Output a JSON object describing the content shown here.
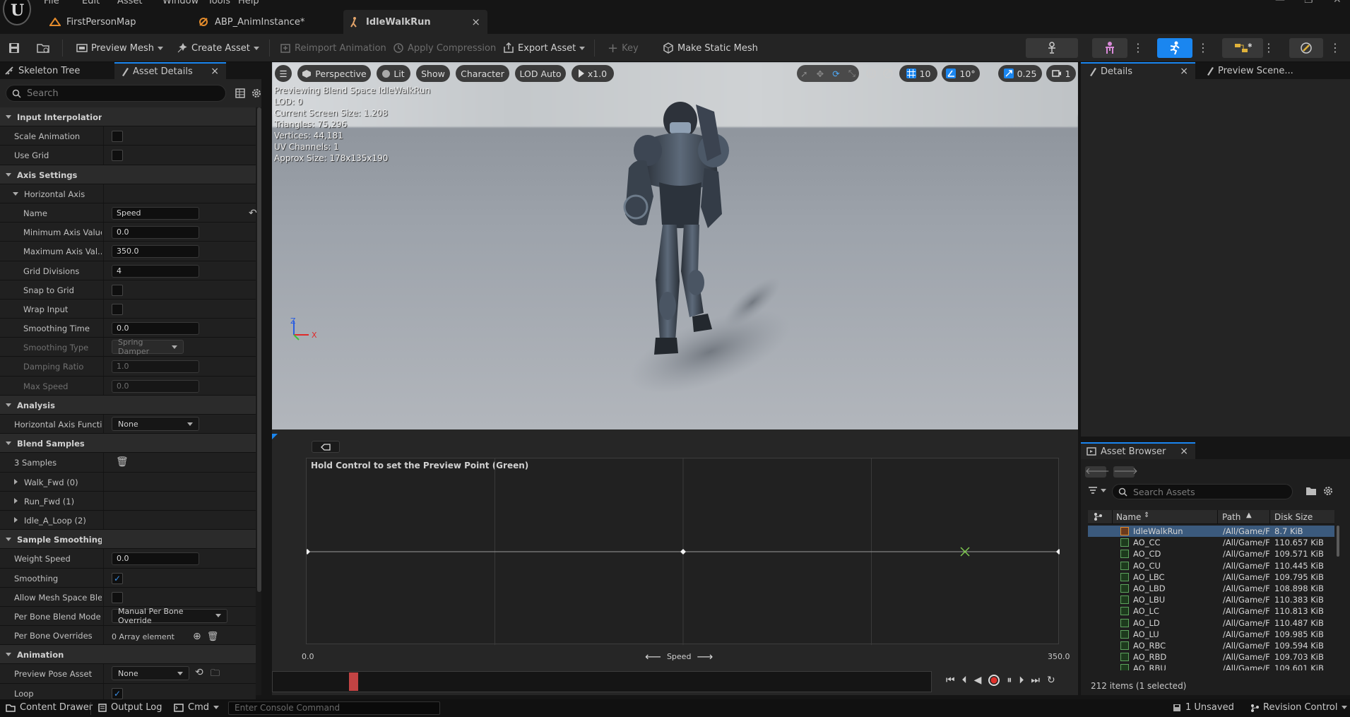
{
  "menu": [
    "File",
    "Edit",
    "Asset",
    "Window",
    "Tools",
    "Help"
  ],
  "doc_tabs": [
    {
      "label": "FirstPersonMap"
    },
    {
      "label": "ABP_AnimInstance*"
    },
    {
      "label": "IdleWalkRun",
      "close": "×"
    }
  ],
  "toolbar": {
    "preview_mesh": "Preview Mesh",
    "create_asset": "Create Asset",
    "reimport": "Reimport Animation",
    "apply_compression": "Apply Compression",
    "export_asset": "Export Asset",
    "key": "Key",
    "make_static_mesh": "Make Static Mesh"
  },
  "left_panel": {
    "tab1": "Skeleton Tree",
    "tab2": "Asset Details",
    "tab2_close": "×",
    "search_placeholder": "Search"
  },
  "props": [
    {
      "type": "cat",
      "label": "Input Interpolation",
      "indent": 0
    },
    {
      "type": "chk",
      "label": "Scale Animation",
      "indent": 1,
      "checked": false
    },
    {
      "type": "chk",
      "label": "Use Grid",
      "indent": 1,
      "checked": false
    },
    {
      "type": "cat",
      "label": "Axis Settings",
      "indent": 0
    },
    {
      "type": "sub",
      "label": "Horizontal Axis",
      "indent": 1
    },
    {
      "type": "inp",
      "label": "Name",
      "indent": 2,
      "value": "Speed",
      "reset": true
    },
    {
      "type": "inp",
      "label": "Minimum Axis Value",
      "indent": 2,
      "value": "0.0"
    },
    {
      "type": "inp",
      "label": "Maximum Axis Val...",
      "indent": 2,
      "value": "350.0"
    },
    {
      "type": "inp",
      "label": "Grid Divisions",
      "indent": 2,
      "value": "4"
    },
    {
      "type": "chk",
      "label": "Snap to Grid",
      "indent": 2,
      "checked": false
    },
    {
      "type": "chk",
      "label": "Wrap Input",
      "indent": 2,
      "checked": false
    },
    {
      "type": "inp",
      "label": "Smoothing Time",
      "indent": 2,
      "value": "0.0"
    },
    {
      "type": "combo",
      "label": "Smoothing Type",
      "indent": 2,
      "value": "Spring Damper",
      "disabled": true,
      "w": 102
    },
    {
      "type": "inp",
      "label": "Damping Ratio",
      "indent": 2,
      "value": "1.0",
      "disabled": true
    },
    {
      "type": "inp",
      "label": "Max Speed",
      "indent": 2,
      "value": "0.0",
      "disabled": true
    },
    {
      "type": "cat",
      "label": "Analysis",
      "indent": 0
    },
    {
      "type": "combo",
      "label": "Horizontal Axis Function",
      "indent": 1,
      "value": "None",
      "w": 124
    },
    {
      "type": "cat",
      "label": "Blend Samples",
      "indent": 0
    },
    {
      "type": "samples",
      "label": "3 Samples",
      "indent": 1
    },
    {
      "type": "exp",
      "label": "Walk_Fwd (0)",
      "indent": 1
    },
    {
      "type": "exp",
      "label": "Run_Fwd (1)",
      "indent": 1
    },
    {
      "type": "exp",
      "label": "Idle_A_Loop (2)",
      "indent": 1
    },
    {
      "type": "cat",
      "label": "Sample Smoothing",
      "indent": 0
    },
    {
      "type": "inp",
      "label": "Weight Speed",
      "indent": 1,
      "value": "0.0"
    },
    {
      "type": "chk",
      "label": "Smoothing",
      "indent": 1,
      "checked": true
    },
    {
      "type": "chk",
      "label": "Allow Mesh Space Ble...",
      "indent": 1,
      "checked": false
    },
    {
      "type": "combo",
      "label": "Per Bone Blend Mode",
      "indent": 1,
      "value": "Manual Per Bone Override",
      "w": 164
    },
    {
      "type": "array",
      "label": "Per Bone Overrides",
      "indent": 1,
      "value": "0 Array element"
    },
    {
      "type": "cat",
      "label": "Animation",
      "indent": 0
    },
    {
      "type": "combo",
      "label": "Preview Pose Asset",
      "indent": 1,
      "value": "None",
      "w": 110,
      "extra": true
    },
    {
      "type": "chk",
      "label": "Loop",
      "indent": 1,
      "checked": true
    }
  ],
  "viewport": {
    "perspective": "Perspective",
    "lit": "Lit",
    "show": "Show",
    "character": "Character",
    "lod": "LOD Auto",
    "speed": "x1.0",
    "grid_snap": "10",
    "rot_snap": "10°",
    "scale_snap": "0.25",
    "cam_speed": "1",
    "stats": [
      "Previewing Blend Space IdleWalkRun",
      "LOD: 0",
      "Current Screen Size: 1.208",
      "Triangles: 75,296",
      "Vertices: 44,181",
      "UV Channels: 1",
      "Approx Size: 178x135x190"
    ],
    "axis_z": "Z",
    "axis_x": "X"
  },
  "blendspace": {
    "hint": "Hold Control to set the Preview Point (Green)",
    "min": "0.0",
    "max": "350.0",
    "axis_label": "Speed",
    "samples": [
      0.0,
      175.0,
      350.0
    ],
    "preview_point": 306.0
  },
  "right_panel": {
    "details": "Details",
    "details_close": "×",
    "preview_scene": "Preview Scene..."
  },
  "asset_browser": {
    "title": "Asset Browser",
    "close": "×",
    "search_placeholder": "Search Assets",
    "col_name": "Name",
    "col_path": "Path",
    "col_size": "Disk Size",
    "rows": [
      {
        "name": "IdleWalkRun",
        "path": "/All/Game/F",
        "size": "8.7 KiB",
        "selected": true
      },
      {
        "name": "AO_CC",
        "path": "/All/Game/F",
        "size": "110.657 KiB"
      },
      {
        "name": "AO_CD",
        "path": "/All/Game/F",
        "size": "109.571 KiB"
      },
      {
        "name": "AO_CU",
        "path": "/All/Game/F",
        "size": "110.445 KiB"
      },
      {
        "name": "AO_LBC",
        "path": "/All/Game/F",
        "size": "109.795 KiB"
      },
      {
        "name": "AO_LBD",
        "path": "/All/Game/F",
        "size": "108.898 KiB"
      },
      {
        "name": "AO_LBU",
        "path": "/All/Game/F",
        "size": "110.383 KiB"
      },
      {
        "name": "AO_LC",
        "path": "/All/Game/F",
        "size": "110.813 KiB"
      },
      {
        "name": "AO_LD",
        "path": "/All/Game/F",
        "size": "110.487 KiB"
      },
      {
        "name": "AO_LU",
        "path": "/All/Game/F",
        "size": "109.985 KiB"
      },
      {
        "name": "AO_RBC",
        "path": "/All/Game/F",
        "size": "109.594 KiB"
      },
      {
        "name": "AO_RBD",
        "path": "/All/Game/F",
        "size": "109.703 KiB"
      },
      {
        "name": "AO_RBU",
        "path": "/All/Game/F",
        "size": "109.601 KiB"
      }
    ],
    "count": "212 items (1 selected)"
  },
  "status": {
    "content_drawer": "Content Drawer",
    "output_log": "Output Log",
    "cmd": "Cmd",
    "console_placeholder": "Enter Console Command",
    "unsaved": "1 Unsaved",
    "revision": "Revision Control"
  },
  "colors": {
    "accent": "#1a86f0",
    "record": "#e0302a",
    "preview_point": "#7ec850"
  }
}
